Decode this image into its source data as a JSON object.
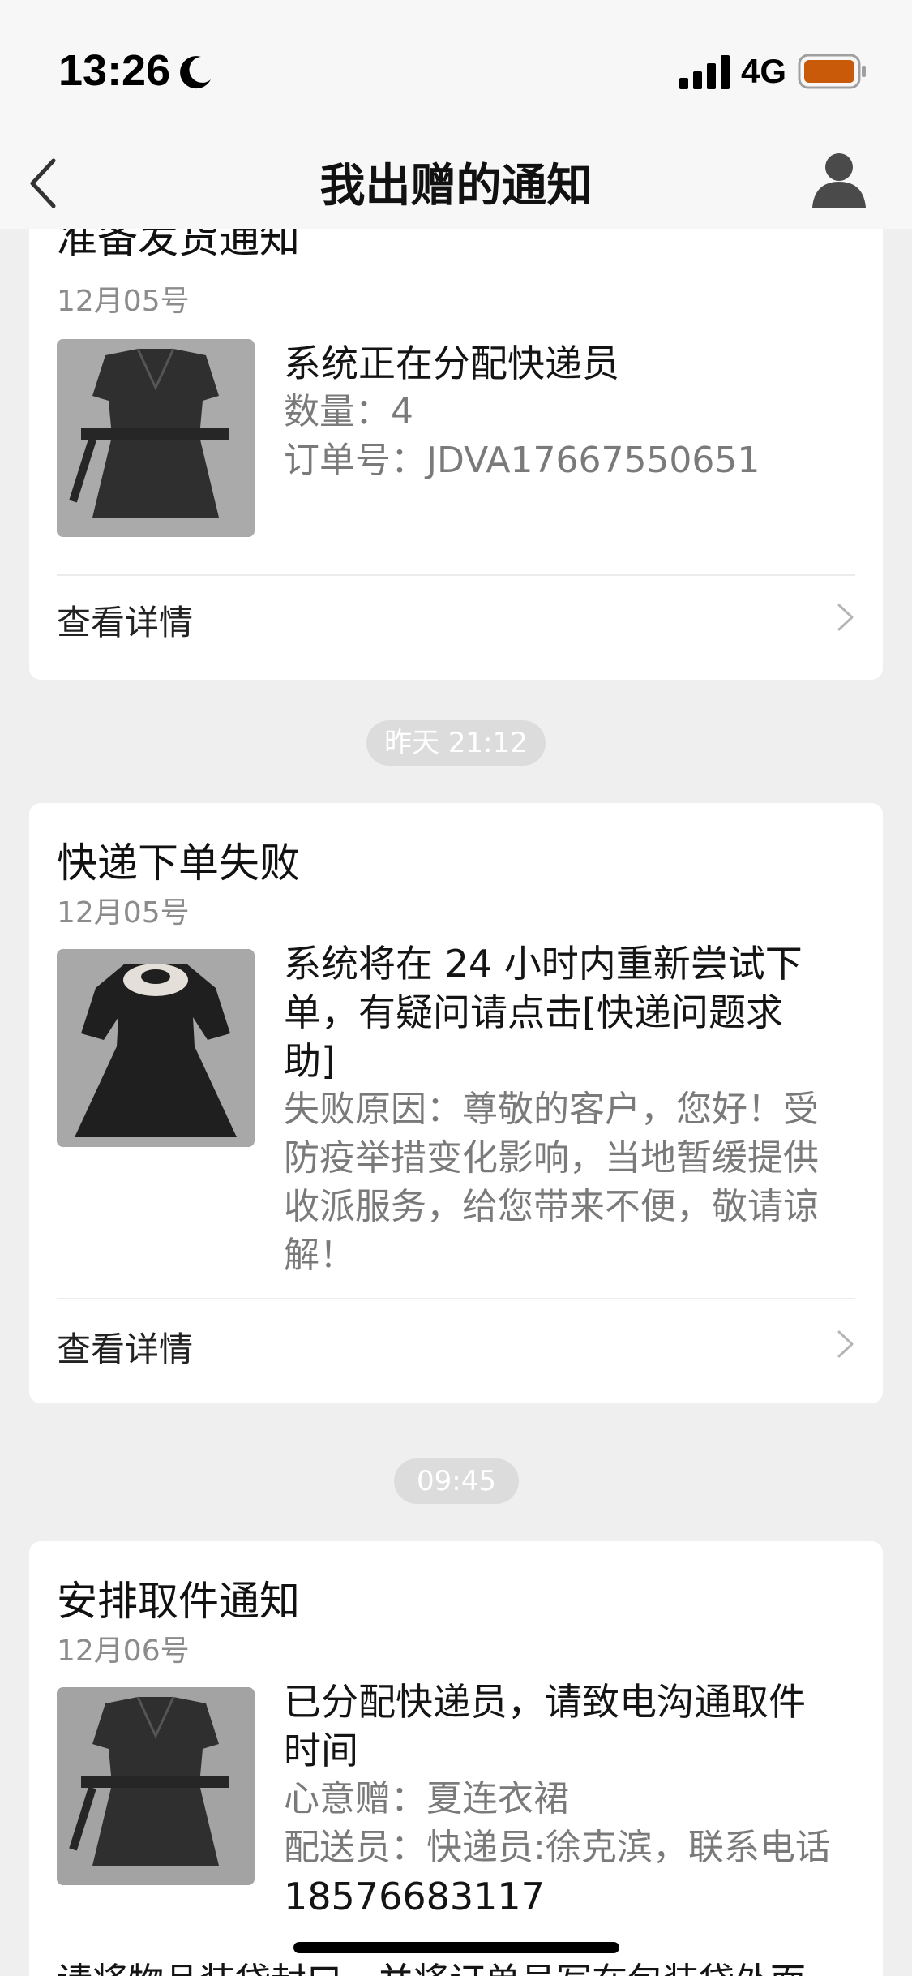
{
  "status_bar": {
    "time": "13:26",
    "network": "4G",
    "battery_color": "#c85a0a"
  },
  "nav": {
    "title": "我出赠的通知"
  },
  "cards": [
    {
      "title": "准备发货通知",
      "date": "12月05号",
      "main": "系统正在分配快递员",
      "sub_lines": [
        "数量：4",
        "订单号：JDVA17667550651"
      ],
      "detail_label": "查看详情"
    },
    {
      "title": "快递下单失败",
      "date": "12月05号",
      "main_lines": [
        "系统将在 24 小时内重新尝试下",
        "单，有疑问请点击[快递问题求",
        "助]"
      ],
      "sub_lines": [
        "失败原因：尊敬的客户，您好！受",
        "防疫举措变化影响，当地暂缓提供",
        "收派服务，给您带来不便，敬请谅",
        "解！"
      ],
      "detail_label": "查看详情"
    },
    {
      "title": "安排取件通知",
      "date": "12月06号",
      "main_lines": [
        "已分配快递员，请致电沟通取件",
        "时间"
      ],
      "sub_lines": [
        "心意赠：夏连衣裙",
        "配送员：快递员:徐克滨，联系电话",
        "18576683117"
      ],
      "footer_text": "请将物品装袋封口，并将订单号写在包装袋外面"
    }
  ],
  "time_separators": [
    "昨天 21:12",
    "09:45"
  ]
}
